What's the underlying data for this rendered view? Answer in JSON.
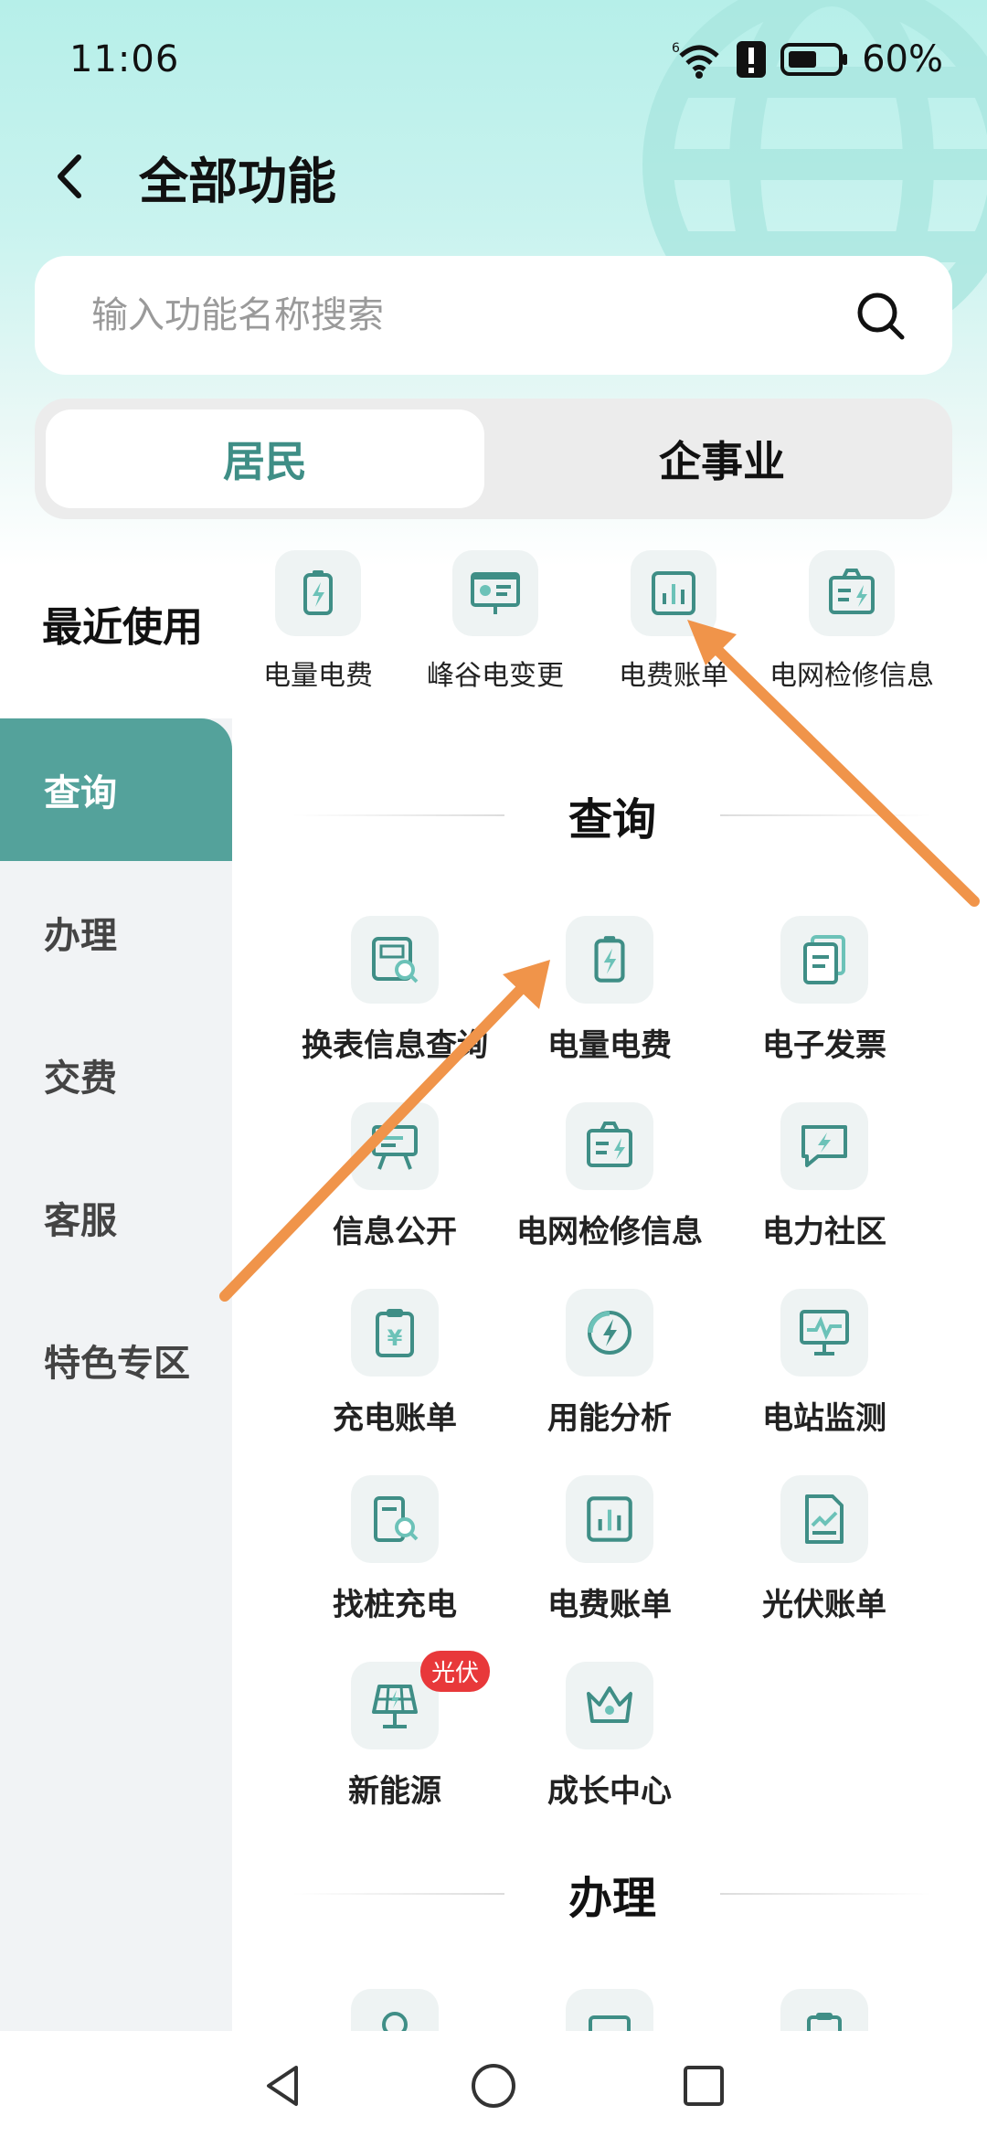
{
  "status_bar": {
    "time": "11:06",
    "battery": "60%"
  },
  "header": {
    "title": "全部功能"
  },
  "search": {
    "placeholder": "输入功能名称搜索"
  },
  "segments": {
    "active": "居民",
    "inactive": "企事业"
  },
  "recent": {
    "title": "最近使用",
    "items": [
      {
        "label": "电量电费",
        "icon": "battery-bolt-icon"
      },
      {
        "label": "峰谷电变更",
        "icon": "presentation-board-icon"
      },
      {
        "label": "电费账单",
        "icon": "bar-chart-icon"
      },
      {
        "label": "电网检修信息",
        "icon": "maintenance-icon"
      }
    ]
  },
  "sidebar": {
    "items": [
      {
        "label": "查询",
        "active": true
      },
      {
        "label": "办理"
      },
      {
        "label": "交费"
      },
      {
        "label": "客服"
      },
      {
        "label": "特色专区"
      }
    ]
  },
  "sections": [
    {
      "title": "查询",
      "items": [
        {
          "label": "换表信息查询",
          "icon": "meter-search-icon"
        },
        {
          "label": "电量电费",
          "icon": "battery-bolt-icon"
        },
        {
          "label": "电子发票",
          "icon": "invoice-icon"
        },
        {
          "label": "信息公开",
          "icon": "easel-icon"
        },
        {
          "label": "电网检修信息",
          "icon": "maintenance-icon"
        },
        {
          "label": "电力社区",
          "icon": "chat-bolt-icon"
        },
        {
          "label": "充电账单",
          "icon": "clipboard-yen-icon"
        },
        {
          "label": "用能分析",
          "icon": "gauge-bolt-icon"
        },
        {
          "label": "电站监测",
          "icon": "monitor-icon"
        },
        {
          "label": "找桩充电",
          "icon": "charger-search-icon"
        },
        {
          "label": "电费账单",
          "icon": "bar-chart-icon"
        },
        {
          "label": "光伏账单",
          "icon": "pv-document-icon"
        },
        {
          "label": "新能源",
          "icon": "solar-panel-icon",
          "badge": "光伏"
        },
        {
          "label": "成长中心",
          "icon": "crown-icon"
        }
      ]
    },
    {
      "title": "办理"
    }
  ],
  "colors": {
    "accent": "#54a29b",
    "accent_text": "#3f8e86",
    "badge": "#e8383a",
    "annotation_arrow": "#f0944a"
  }
}
